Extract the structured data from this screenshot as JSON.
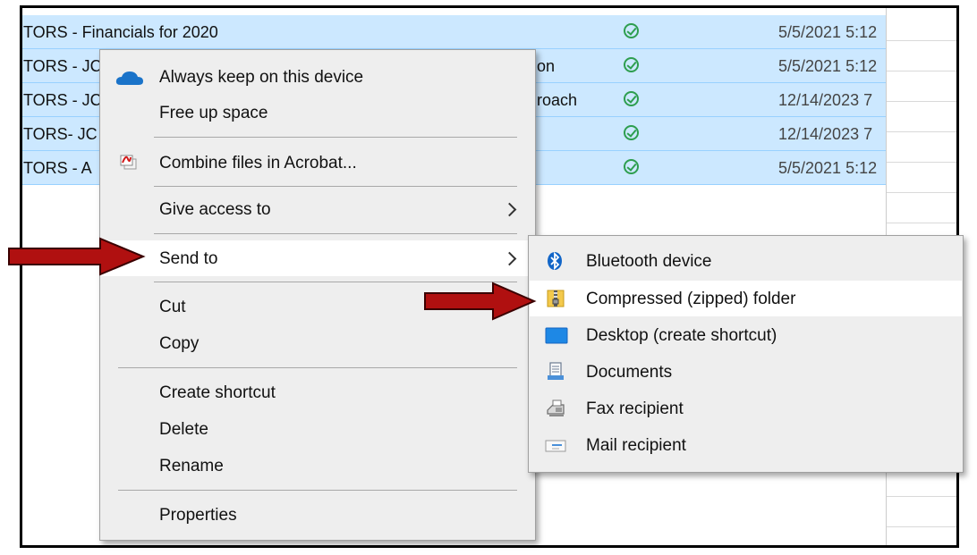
{
  "explorer": {
    "rows": [
      {
        "name": "TORS - Financials for 2020",
        "extra": "",
        "date": "5/5/2021 5:12"
      },
      {
        "name": "TORS - JC",
        "extra": "on",
        "date": "5/5/2021 5:12"
      },
      {
        "name": "TORS - JC",
        "extra": "roach",
        "date": "12/14/2023 7"
      },
      {
        "name": "TORS-  JC",
        "extra": "",
        "date": "12/14/2023 7"
      },
      {
        "name": "TORS - A",
        "extra": "",
        "date": "5/5/2021 5:12"
      }
    ]
  },
  "context_menu": {
    "always_keep": "Always keep on this device",
    "free_up": "Free up space",
    "combine": "Combine files in Acrobat...",
    "give_access": "Give access to",
    "send_to": "Send to",
    "cut": "Cut",
    "copy": "Copy",
    "create_shortcut": "Create shortcut",
    "delete": "Delete",
    "rename": "Rename",
    "properties": "Properties"
  },
  "send_to_menu": {
    "bluetooth": "Bluetooth device",
    "compressed": "Compressed (zipped) folder",
    "desktop": "Desktop (create shortcut)",
    "documents": "Documents",
    "fax": "Fax recipient",
    "mail": "Mail recipient"
  },
  "icons": {
    "status": "sync-check-icon",
    "onedrive": "onedrive-cloud-icon",
    "acrobat": "acrobat-combine-icon",
    "bluetooth": "bluetooth-icon",
    "zip": "zip-folder-icon",
    "desktop": "desktop-icon",
    "documents": "documents-icon",
    "fax": "fax-icon",
    "mail": "mail-icon",
    "annotation_arrow": "red-arrow-icon"
  },
  "colors": {
    "selection": "#cce8ff",
    "menu_bg": "#eeeeee",
    "menu_highlight": "#ffffff",
    "status_green": "#2e9e4f",
    "annotation_red": "#b01010",
    "onedrive_blue": "#1a73c9"
  }
}
